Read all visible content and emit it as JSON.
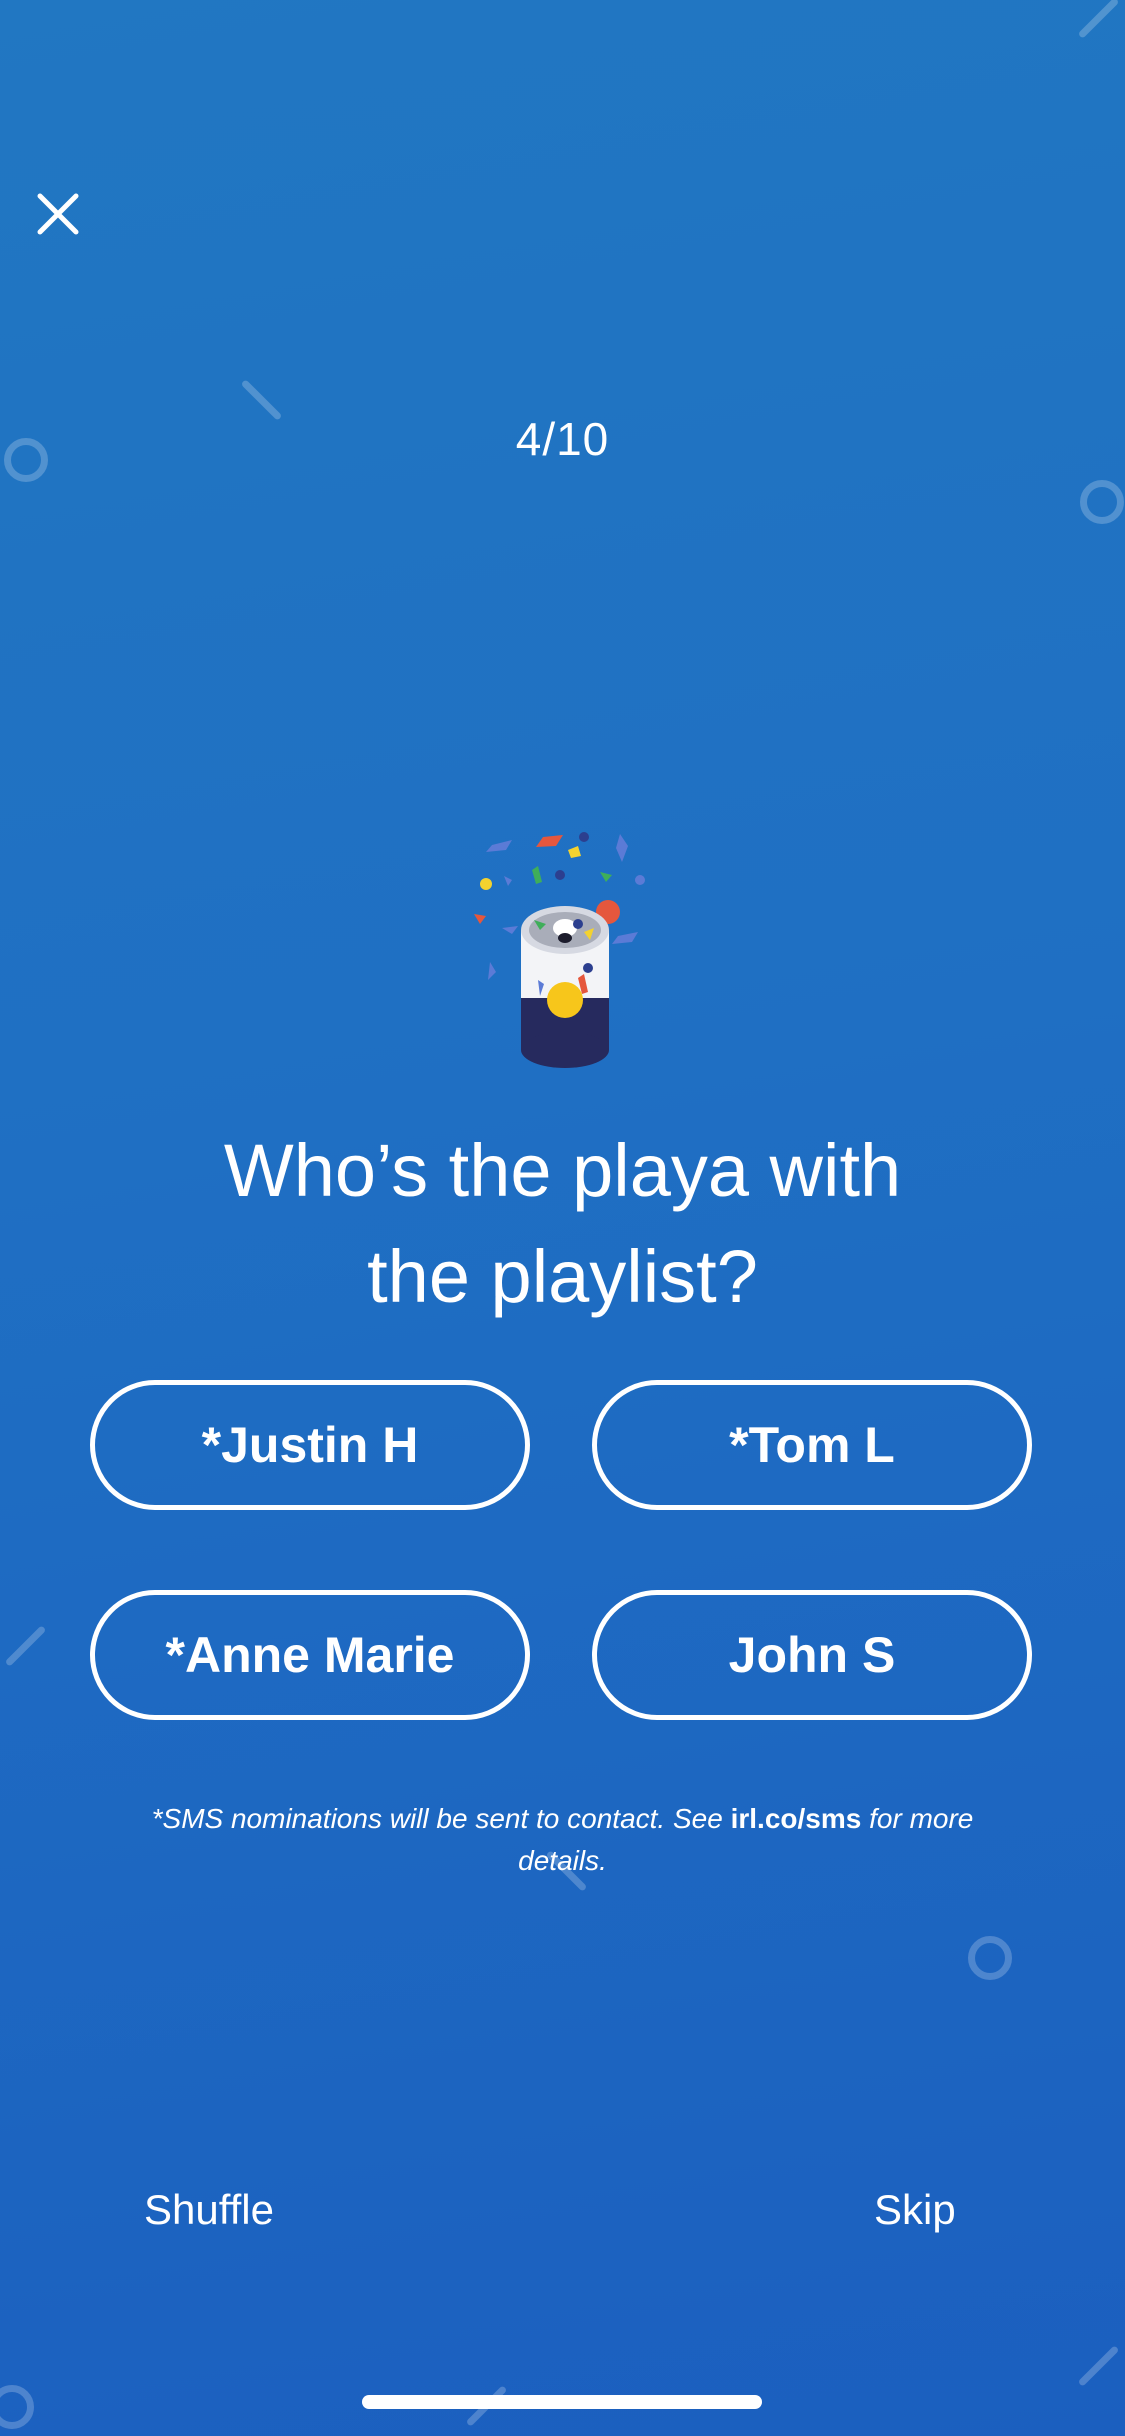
{
  "header": {
    "close_icon": "close-icon",
    "progress": "4/10"
  },
  "hero": {
    "icon": "soda-can-confetti-icon"
  },
  "question": {
    "line1": "Who’s the playa with",
    "line2": "the playlist?"
  },
  "options": [
    {
      "label": "*Justin H"
    },
    {
      "label": "*Tom L"
    },
    {
      "label": "*Anne Marie"
    },
    {
      "label": "John S"
    }
  ],
  "disclaimer": {
    "prefix": "*SMS nominations will be sent to contact. See ",
    "link": "irl.co/sms",
    "suffix": " for more details."
  },
  "footer": {
    "shuffle_label": "Shuffle",
    "skip_label": "Skip"
  },
  "colors": {
    "background_top": "#2177c2",
    "background_bottom": "#1b5fbf",
    "foreground": "#ffffff"
  }
}
